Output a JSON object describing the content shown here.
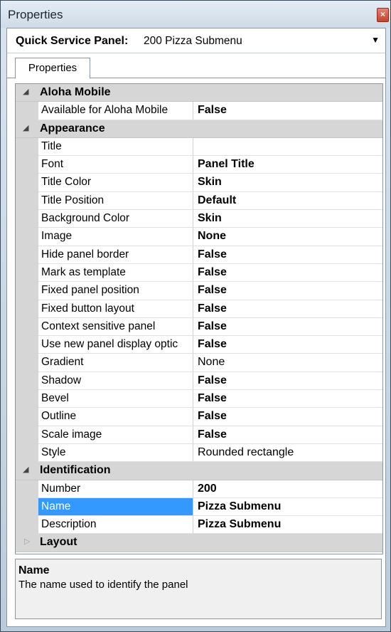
{
  "window": {
    "title": "Properties",
    "close_glyph": "×"
  },
  "selector": {
    "type": "Quick Service Panel:",
    "value": "200 Pizza Submenu",
    "arrow": "▼"
  },
  "tabs": [
    {
      "label": "Properties",
      "active": true
    }
  ],
  "categories": {
    "aloha_mobile": {
      "label": "Aloha Mobile",
      "expanded": true,
      "glyph": "◢"
    },
    "appearance": {
      "label": "Appearance",
      "expanded": true,
      "glyph": "◢"
    },
    "identification": {
      "label": "Identification",
      "expanded": true,
      "glyph": "◢"
    },
    "layout": {
      "label": "Layout",
      "expanded": false,
      "glyph": "▷"
    }
  },
  "props": {
    "available_for_aloha_mobile": {
      "name": "Available for Aloha Mobile",
      "value": "False"
    },
    "title": {
      "name": "Title",
      "value": ""
    },
    "font": {
      "name": "Font",
      "value": "Panel Title"
    },
    "title_color": {
      "name": "Title Color",
      "value": "Skin"
    },
    "title_position": {
      "name": "Title Position",
      "value": "Default"
    },
    "background_color": {
      "name": "Background Color",
      "value": "Skin"
    },
    "image": {
      "name": "Image",
      "value": "None"
    },
    "hide_panel_border": {
      "name": "Hide panel border",
      "value": "False"
    },
    "mark_as_template": {
      "name": "Mark as template",
      "value": "False"
    },
    "fixed_panel_position": {
      "name": "Fixed panel position",
      "value": "False"
    },
    "fixed_button_layout": {
      "name": "Fixed button layout",
      "value": "False"
    },
    "context_sensitive_panel": {
      "name": "Context sensitive panel",
      "value": "False"
    },
    "use_new_panel_display": {
      "name": "Use new panel display optic",
      "value": "False"
    },
    "gradient": {
      "name": "Gradient",
      "value": "None"
    },
    "shadow": {
      "name": "Shadow",
      "value": "False"
    },
    "bevel": {
      "name": "Bevel",
      "value": "False"
    },
    "outline": {
      "name": "Outline",
      "value": "False"
    },
    "scale_image": {
      "name": "Scale image",
      "value": "False"
    },
    "style": {
      "name": "Style",
      "value": "Rounded rectangle"
    },
    "number": {
      "name": "Number",
      "value": "200"
    },
    "name": {
      "name": "Name",
      "value": "Pizza Submenu",
      "selected": true
    },
    "description": {
      "name": "Description",
      "value": "Pizza Submenu"
    }
  },
  "description_panel": {
    "title": "Name",
    "text": "The name used to identify the panel"
  },
  "colors": {
    "selection": "#3399ff",
    "category_bg": "#d6d6d6",
    "title_bar": "#d5e1ee"
  }
}
